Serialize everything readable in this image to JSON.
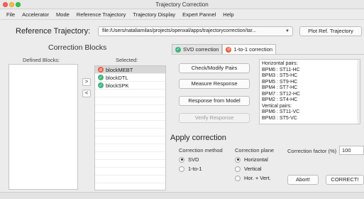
{
  "window": {
    "title": "Trajectory Correction"
  },
  "menu": [
    "File",
    "Accelerator",
    "Mode",
    "Reference Trajectory",
    "Trajectory Display",
    "Expert Pannel",
    "Help"
  ],
  "reference": {
    "label": "Reference Trajectory:",
    "path": "file:/Users/nataliamilas/projects/openxal/apps/trajectorycorrection/tar...",
    "plot_button": "Plot Ref. Trajectory"
  },
  "correction_blocks": {
    "title": "Correction Blocks",
    "defined_label": "Defined Blocks:",
    "selected_label": "Selected:",
    "move_right": ">",
    "move_left": "<",
    "selected": [
      {
        "name": "blockMEBT",
        "status": "red"
      },
      {
        "name": "blockDTL",
        "status": "green"
      },
      {
        "name": "blockSPK",
        "status": "green"
      }
    ]
  },
  "tabs": [
    {
      "label": "SVD correction",
      "status": "green"
    },
    {
      "label": "1-to-1 correction",
      "status": "red"
    }
  ],
  "actions": {
    "check_pairs": "Check/Modify Pairs",
    "measure": "Measure Response",
    "from_model": "Response from Model",
    "verify": "Verify Response"
  },
  "pairs": [
    "Horizontal pairs:",
    "BPM6 : ST11-HC",
    "BPM3 : ST5-HC",
    "BPM5 : ST9-HC",
    "BPM4 : ST7-HC",
    "BPM7 : ST12-HC",
    "BPM2 : ST4-HC",
    "Vertical pairs:",
    "BPM6 : ST11-VC",
    "BPM3 : ST5-VC"
  ],
  "apply": {
    "title": "Apply correction",
    "method_label": "Correction method",
    "methods": [
      "SVD",
      "1-to-1"
    ],
    "plane_label": "Correction plane",
    "planes": [
      "Horizontal",
      "Vertical",
      "Hor. + Vert."
    ],
    "factor_label": "Correction factor (%)",
    "factor_value": "100",
    "abort": "Abort!",
    "correct": "CORRECT!"
  },
  "colors": {
    "red_status": "#e85a3e",
    "green_status": "#3fb37f"
  }
}
